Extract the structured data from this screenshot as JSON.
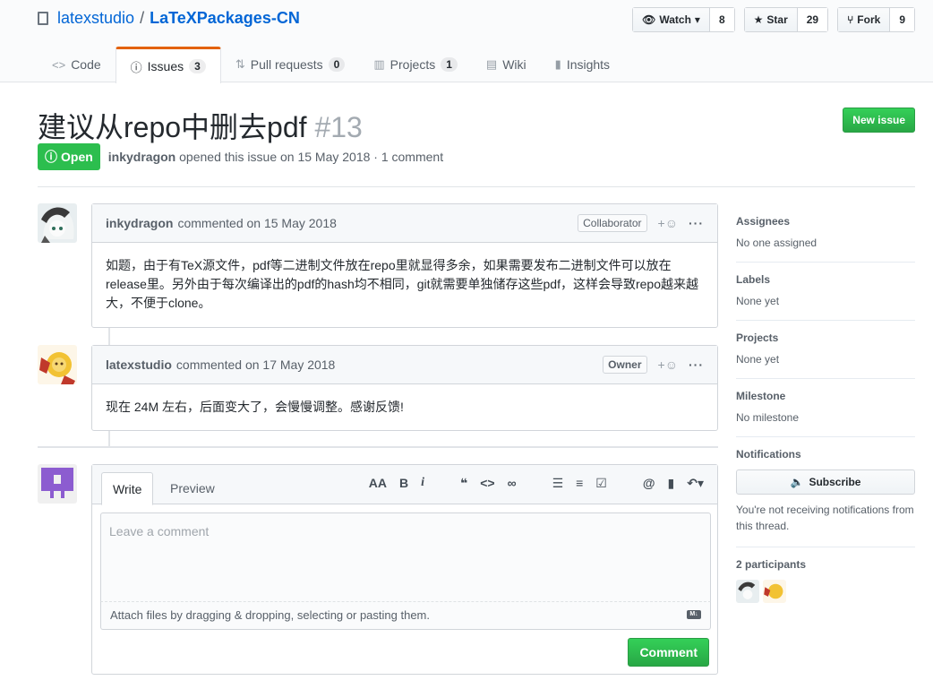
{
  "repo": {
    "owner": "latexstudio",
    "separator": "/",
    "name": "LaTeXPackages-CN"
  },
  "actions": {
    "watch": {
      "label": "Watch",
      "count": "8"
    },
    "star": {
      "label": "Star",
      "count": "29"
    },
    "fork": {
      "label": "Fork",
      "count": "9"
    }
  },
  "tabs": [
    {
      "label": "Code"
    },
    {
      "label": "Issues",
      "count": "3"
    },
    {
      "label": "Pull requests",
      "count": "0"
    },
    {
      "label": "Projects",
      "count": "1"
    },
    {
      "label": "Wiki"
    },
    {
      "label": "Insights"
    }
  ],
  "issue": {
    "title": "建议从repo中删去pdf",
    "number": "#13",
    "state": "Open",
    "author": "inkydragon",
    "meta_text": "opened this issue on 15 May 2018 · 1 comment",
    "new_issue_label": "New issue"
  },
  "comments": [
    {
      "author": "inkydragon",
      "action": "commented on 15 May 2018",
      "role": "Collaborator",
      "body": "如题，由于有TeX源文件，pdf等二进制文件放在repo里就显得多余，如果需要发布二进制文件可以放在release里。另外由于每次编译出的pdf的hash均不相同，git就需要单独储存这些pdf，这样会导致repo越来越大，不便于clone。"
    },
    {
      "author": "latexstudio",
      "action": "commented on 17 May 2018",
      "role": "Owner",
      "body": "现在 24M 左右，后面变大了，会慢慢调整。感谢反馈!"
    }
  ],
  "form": {
    "tab_write": "Write",
    "tab_preview": "Preview",
    "placeholder": "Leave a comment",
    "attach_text": "Attach files by dragging & dropping, selecting or pasting them.",
    "markdown_badge": "M↓",
    "submit_label": "Comment"
  },
  "sidebar": {
    "assignees": {
      "title": "Assignees",
      "value": "No one assigned"
    },
    "labels": {
      "title": "Labels",
      "value": "None yet"
    },
    "projects": {
      "title": "Projects",
      "value": "None yet"
    },
    "milestone": {
      "title": "Milestone",
      "value": "No milestone"
    },
    "notifications": {
      "title": "Notifications",
      "button": "Subscribe",
      "note": "You're not receiving notifications from this thread."
    },
    "participants": {
      "title": "2 participants"
    }
  },
  "colors": {
    "link": "#0366d6",
    "green": "#28a745",
    "tab_accent": "#e36209"
  }
}
